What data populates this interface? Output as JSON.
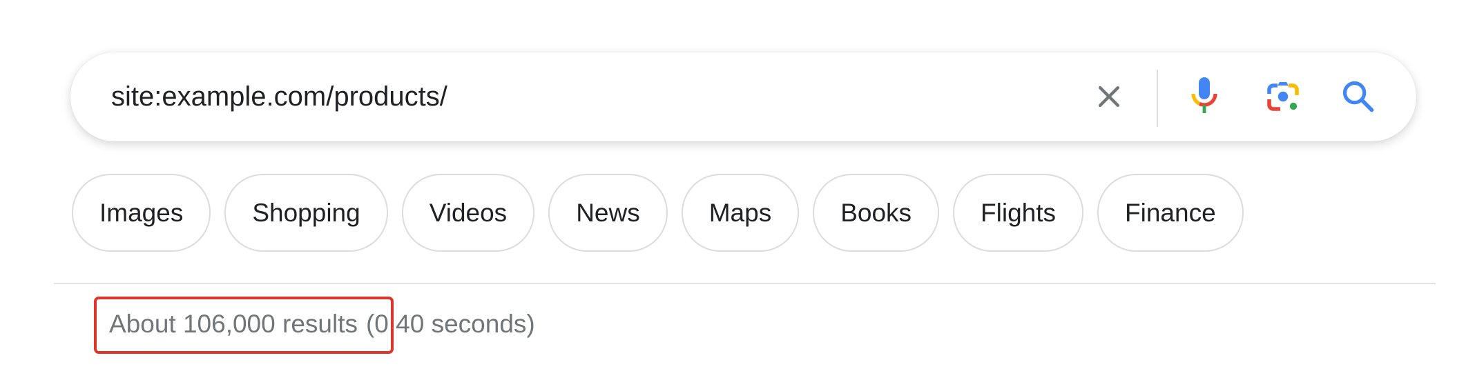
{
  "search": {
    "query": "site:example.com/products/",
    "clear_icon": "close-icon",
    "voice_icon": "microphone-icon",
    "lens_icon": "camera-lens-icon",
    "search_icon": "search-icon"
  },
  "filters": [
    {
      "label": "Images"
    },
    {
      "label": "Shopping"
    },
    {
      "label": "Videos"
    },
    {
      "label": "News"
    },
    {
      "label": "Maps"
    },
    {
      "label": "Books"
    },
    {
      "label": "Flights"
    },
    {
      "label": "Finance"
    }
  ],
  "results_stats": {
    "count_text": "About 106,000 results",
    "time_text": "(0.40 seconds)"
  },
  "colors": {
    "google_blue": "#4285f4",
    "google_red": "#ea4335",
    "google_yellow": "#fbbc04",
    "google_green": "#34a853",
    "highlight_red": "#e0352b",
    "muted_text": "#70757a"
  }
}
